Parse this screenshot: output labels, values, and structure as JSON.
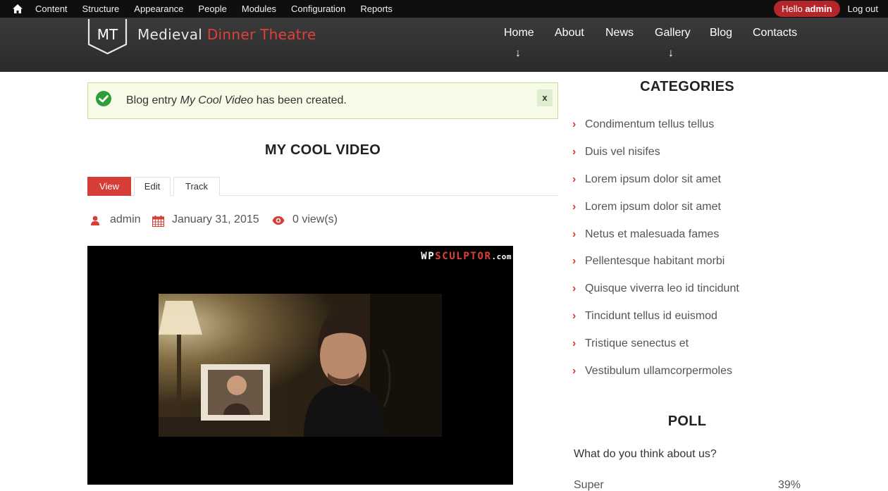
{
  "admin_toolbar": {
    "items": [
      "Content",
      "Structure",
      "Appearance",
      "People",
      "Modules",
      "Configuration",
      "Reports"
    ],
    "hello_prefix": "Hello",
    "hello_user": "admin",
    "logout": "Log out"
  },
  "header": {
    "logo_text": "MT",
    "site_name_part1": "Medieval",
    "site_name_part2": "Dinner Theatre",
    "nav": [
      {
        "label": "Home",
        "has_arrow": true
      },
      {
        "label": "About",
        "has_arrow": false
      },
      {
        "label": "News",
        "has_arrow": false
      },
      {
        "label": "Gallery",
        "has_arrow": true
      },
      {
        "label": "Blog",
        "has_arrow": false
      },
      {
        "label": "Contacts",
        "has_arrow": false
      }
    ],
    "arrow_glyph": "↓"
  },
  "status_message": {
    "prefix": "Blog entry",
    "title": "My Cool Video",
    "suffix": "has been created.",
    "close": "x"
  },
  "article": {
    "title": "MY COOL VIDEO",
    "tabs": [
      "View",
      "Edit",
      "Track"
    ],
    "active_tab": "View",
    "author": "admin",
    "date": "January 31, 2015",
    "views": "0 view(s)",
    "video_watermark": {
      "part1": "WP",
      "part2": "SCULPTOR",
      "part3": ".com"
    }
  },
  "sidebar": {
    "categories_title": "CATEGORIES",
    "categories": [
      "Condimentum tellus tellus",
      "Duis vel nisifes",
      "Lorem ipsum dolor sit amet",
      "Lorem ipsum dolor sit amet",
      "Netus et malesuada fames",
      "Pellentesque habitant morbi",
      "Quisque viverra leo id tincidunt",
      "Tincidunt tellus id euismod",
      "Tristique senectus et",
      "Vestibulum ullamcorpermoles"
    ],
    "poll_title": "POLL",
    "poll_question": "What do you think about us?",
    "poll_options": [
      {
        "label": "Super",
        "percent": "39%"
      }
    ]
  },
  "colors": {
    "accent": "#d63d36",
    "toolbar_bg": "#0f0f0f",
    "header_bg": "#333333",
    "success_border": "#c7e08f"
  }
}
